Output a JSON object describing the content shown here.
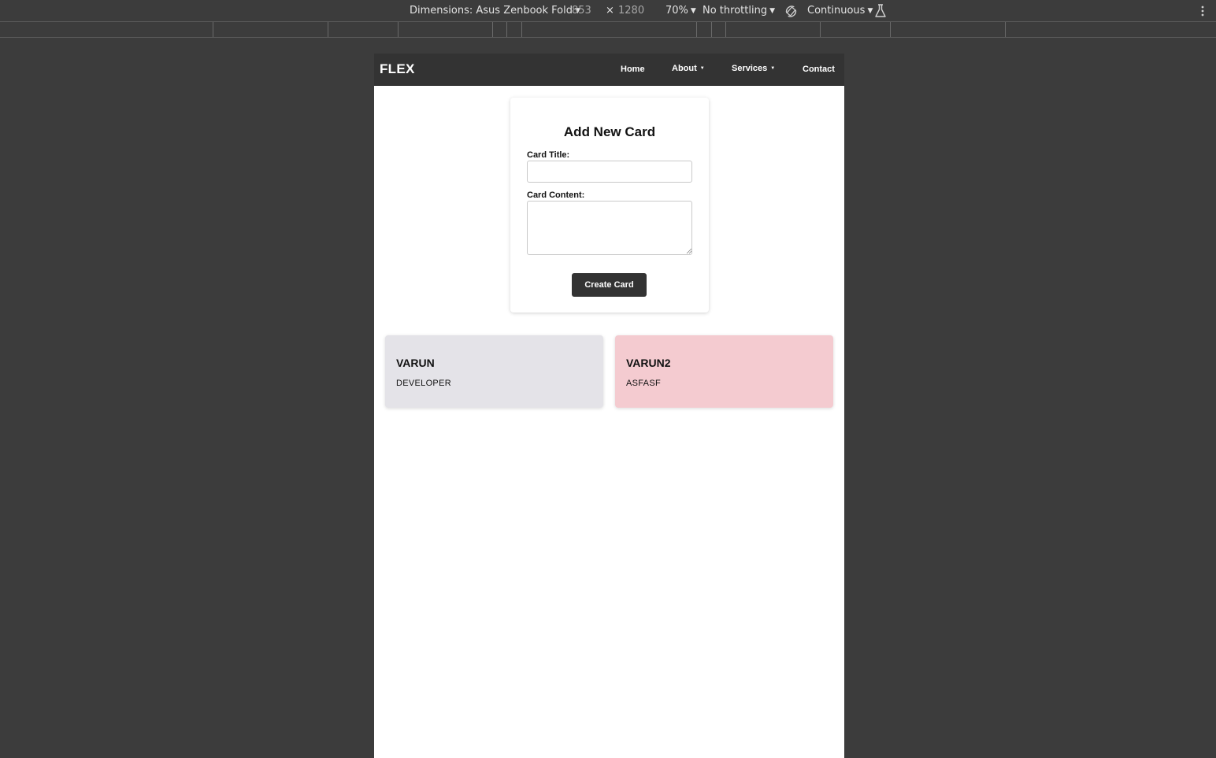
{
  "devtools": {
    "device_label": "Dimensions: Asus Zenbook Fold",
    "width": "853",
    "times": "×",
    "height": "1280",
    "zoom": "70%",
    "throttling": "No throttling",
    "mode": "Continuous"
  },
  "navbar": {
    "brand": "FLEX",
    "links": [
      {
        "label": "Home"
      },
      {
        "label": "About"
      },
      {
        "label": "Services"
      },
      {
        "label": "Contact"
      }
    ]
  },
  "form": {
    "title": "Add New Card",
    "title_label": "Card Title:",
    "title_value": "",
    "content_label": "Card Content:",
    "content_value": "",
    "button_label": "Create Card"
  },
  "cards": [
    {
      "title": "VARUN",
      "content": "DEVELOPER",
      "color": "#e4e3e8"
    },
    {
      "title": "VARUN2",
      "content": "ASFASF",
      "color": "#f4cbd0"
    }
  ],
  "colors": {
    "navbar_bg": "#333333",
    "page_bg": "#3c3c3c",
    "button_bg": "#333333"
  }
}
